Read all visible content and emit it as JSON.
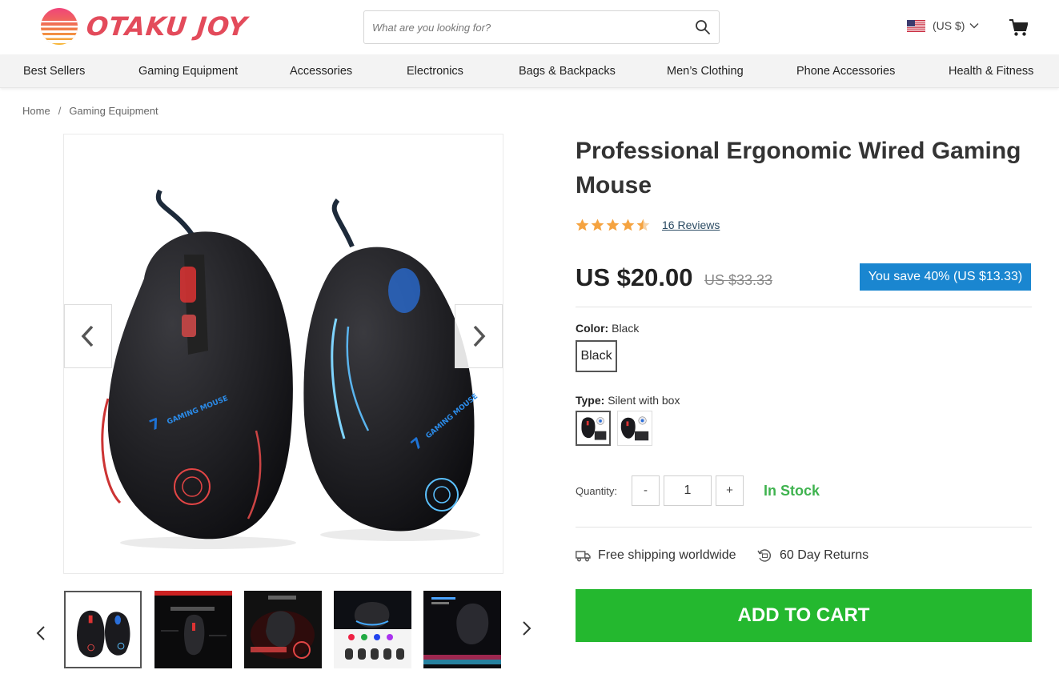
{
  "header": {
    "logo_text": "OTAKU JOY",
    "search_placeholder": "What are you looking for?",
    "currency_label": "(US $)",
    "icons": [
      "search-icon",
      "us-flag-icon",
      "chevron-down-icon",
      "cart-icon"
    ]
  },
  "nav": {
    "items": [
      {
        "label": "Best Sellers"
      },
      {
        "label": "Gaming Equipment"
      },
      {
        "label": "Accessories"
      },
      {
        "label": "Electronics"
      },
      {
        "label": "Bags & Backpacks"
      },
      {
        "label": "Men’s Clothing"
      },
      {
        "label": "Phone Accessories"
      },
      {
        "label": "Health & Fitness"
      }
    ]
  },
  "breadcrumb": {
    "items": [
      "Home",
      "Gaming Equipment"
    ],
    "separator": "/"
  },
  "gallery": {
    "thumbnail_count": 5,
    "active_thumbnail": 1
  },
  "product": {
    "title": "Professional Ergonomic Wired Gaming Mouse",
    "rating": 4.5,
    "rating_max": 5,
    "reviews_label": "16 Reviews",
    "price": "US $20.00",
    "old_price": "US $33.33",
    "save_label": "You save 40% (US $13.33)",
    "color_label": "Color:",
    "color_value": "Black",
    "color_options": [
      "Black"
    ],
    "type_label": "Type:",
    "type_value": "Silent with box",
    "type_option_count": 2,
    "quantity_label": "Quantity:",
    "quantity_value": "1",
    "qty_minus": "-",
    "qty_plus": "+",
    "stock_status": "In Stock",
    "perks": [
      {
        "icon": "truck-icon",
        "label": "Free shipping worldwide"
      },
      {
        "icon": "returns-icon",
        "label": "60 Day Returns"
      }
    ],
    "add_to_cart_label": "ADD TO CART"
  },
  "colors": {
    "accent_green": "#24b82f",
    "stock_green": "#3fb34f",
    "save_blue": "#1a86d0",
    "logo_red": "#e34b5b",
    "star_orange": "#f5a340"
  }
}
